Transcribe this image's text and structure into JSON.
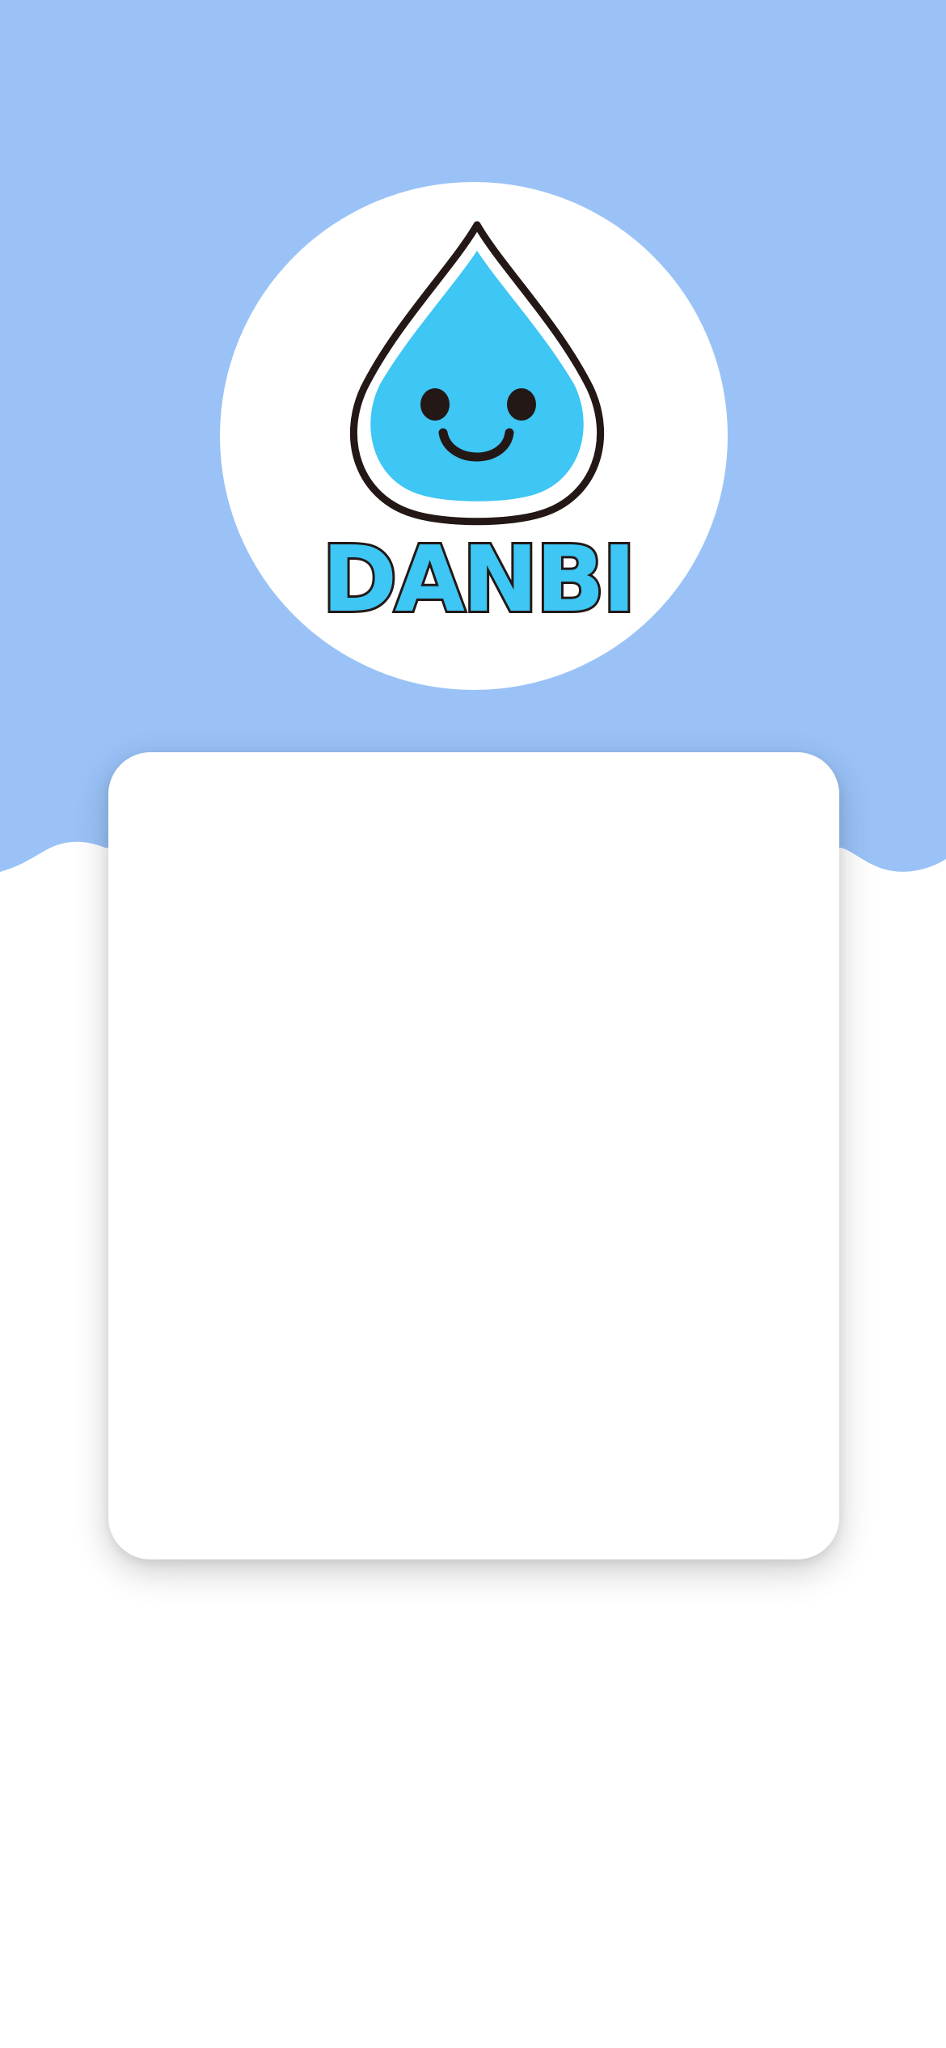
{
  "app": {
    "name": "DANBI"
  },
  "logo": {
    "wordmark": "DANBI",
    "icon": "water-drop-smiley-icon"
  },
  "colors": {
    "header_blue": "#9ac2f7",
    "drop_blue": "#3ec6f4",
    "outline": "#231815",
    "card": "#ffffff",
    "background": "#ffffff"
  }
}
